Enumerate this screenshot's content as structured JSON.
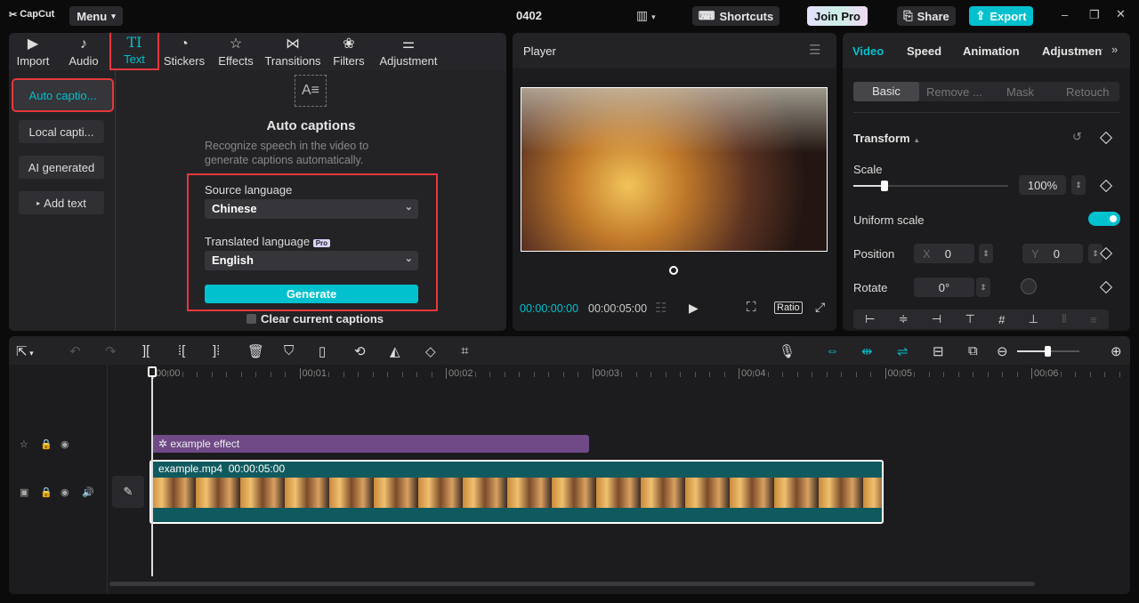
{
  "app": {
    "logo": "CapCut",
    "menu": "Menu",
    "project": "0402",
    "shortcuts": "Shortcuts",
    "join_pro": "Join Pro",
    "share": "Share",
    "export": "Export"
  },
  "tabs": [
    {
      "label": "Import",
      "icon": "import-icon",
      "glyph": "▶"
    },
    {
      "label": "Audio",
      "icon": "audio-icon",
      "glyph": "♪"
    },
    {
      "label": "Text",
      "icon": "text-icon",
      "glyph": "TI"
    },
    {
      "label": "Stickers",
      "icon": "sticker-icon",
      "glyph": "◔"
    },
    {
      "label": "Effects",
      "icon": "effects-icon",
      "glyph": "☆"
    },
    {
      "label": "Transitions",
      "icon": "transitions-icon",
      "glyph": "⋈"
    },
    {
      "label": "Filters",
      "icon": "filters-icon",
      "glyph": "❀"
    },
    {
      "label": "Adjustment",
      "icon": "adjustment-icon",
      "glyph": "⚌"
    }
  ],
  "text_sidebar": [
    "Auto captio...",
    "Local capti...",
    "AI generated",
    "Add text"
  ],
  "captions": {
    "title": "Auto captions",
    "desc": "Recognize speech in the video to generate captions automatically.",
    "source_label": "Source language",
    "source_value": "Chinese",
    "translated_label": "Translated language",
    "pro_badge": "Pro",
    "translated_value": "English",
    "generate": "Generate",
    "clear": "Clear current captions"
  },
  "player": {
    "title": "Player",
    "current_time": "00:00:00:00",
    "total_time": "00:00:05:00",
    "ratio": "Ratio"
  },
  "inspector": {
    "tabs": [
      "Video",
      "Speed",
      "Animation",
      "Adjustment"
    ],
    "subtabs": [
      "Basic",
      "Remove ...",
      "Mask",
      "Retouch"
    ],
    "section": "Transform",
    "scale_label": "Scale",
    "scale_value": "100%",
    "scale_fraction": 0.2,
    "uniform_label": "Uniform scale",
    "uniform_on": true,
    "position_label": "Position",
    "x_label": "X",
    "x_value": "0",
    "y_label": "Y",
    "y_value": "0",
    "rotate_label": "Rotate",
    "rotate_value": "0°"
  },
  "timeline": {
    "ticks": [
      "00:00",
      "00:01",
      "00:02",
      "00:03",
      "00:04",
      "00:05",
      "00:06"
    ],
    "effect_clip": "example effect",
    "video_clip": "example.mp4",
    "video_duration": "00:00:05:00"
  },
  "colors": {
    "accent": "#00c1cd",
    "effect": "#6f4a86",
    "video": "#0f5a5e"
  }
}
